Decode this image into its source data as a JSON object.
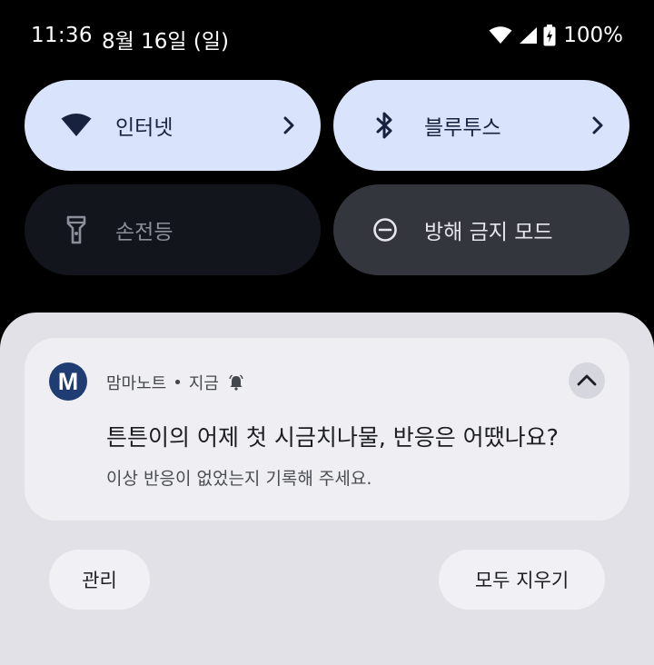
{
  "status_bar": {
    "time": "11:36",
    "date": "8월 16일 (일)",
    "battery": "100%",
    "icons": [
      "wifi-icon",
      "cellular-signal-icon",
      "battery-charging-icon"
    ]
  },
  "quick_tiles": [
    {
      "label": "인터넷",
      "icon": "wifi-icon",
      "state": "on",
      "has_chevron": true
    },
    {
      "label": "블루투스",
      "icon": "bluetooth-icon",
      "state": "on",
      "has_chevron": true
    },
    {
      "label": "손전등",
      "icon": "flashlight-icon",
      "state": "off"
    },
    {
      "label": "방해 금지 모드",
      "icon": "do-not-disturb-icon",
      "state": "off"
    }
  ],
  "notification": {
    "app_initial": "M",
    "app_name": "맘마노트",
    "separator": "•",
    "time": "지금",
    "alert_icon": "bell-icon",
    "title": "튼튼이의 어제 첫 시금치나물, 반응은 어땠나요?",
    "body": "이상 반응이 없었는지 기록해 주세요.",
    "expand_icon": "chevron-up-icon"
  },
  "actions": {
    "manage": "관리",
    "clear_all": "모두 지우기"
  },
  "colors": {
    "tile_active_bg": "#d9e3fb",
    "tile_inactive_bg": "#34363d",
    "shade_bg": "#e1e1e7",
    "card_bg": "#efeff3",
    "app_avatar_bg": "#1f3d73"
  }
}
